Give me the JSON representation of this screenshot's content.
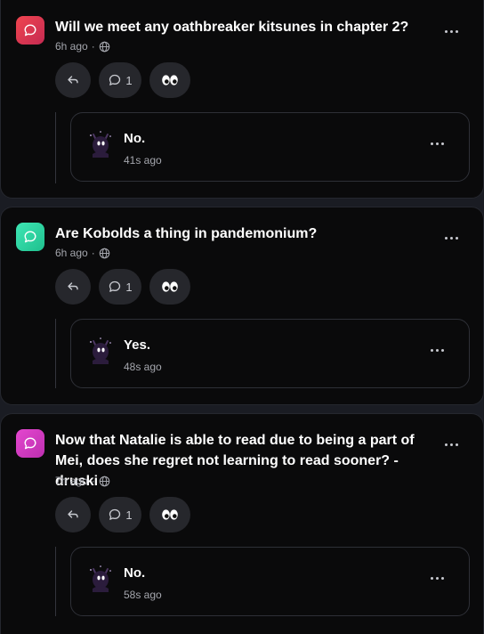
{
  "posts": [
    {
      "question": "Will we meet any oathbreaker kitsunes in chapter 2?",
      "time": "6h ago",
      "visibility_icon": "globe-icon",
      "avatar_color": "#e23c45",
      "comment_count": "1",
      "reaction_icon": "eyes-icon",
      "reply": {
        "text": "No.",
        "time": "41s ago"
      }
    },
    {
      "question": "Are Kobolds a thing in pandemonium?",
      "time": "6h ago",
      "visibility_icon": "globe-icon",
      "avatar_color": "#2ed3a0",
      "comment_count": "1",
      "reaction_icon": "eyes-icon",
      "reply": {
        "text": "Yes.",
        "time": "48s ago"
      }
    },
    {
      "question": "Now that Natalie is able to read due to being a part of Mei, does she regret not learning to read sooner? -druski",
      "time": "7h ago",
      "visibility_icon": "globe-icon",
      "avatar_color": "#d63bbf",
      "comment_count": "1",
      "reaction_icon": "eyes-icon",
      "reply": {
        "text": "No.",
        "time": "58s ago"
      }
    }
  ],
  "colors": {
    "background": "#1a1c23",
    "card": "#0a0a0b",
    "button": "#26272c",
    "muted_text": "#a4a6ad"
  }
}
